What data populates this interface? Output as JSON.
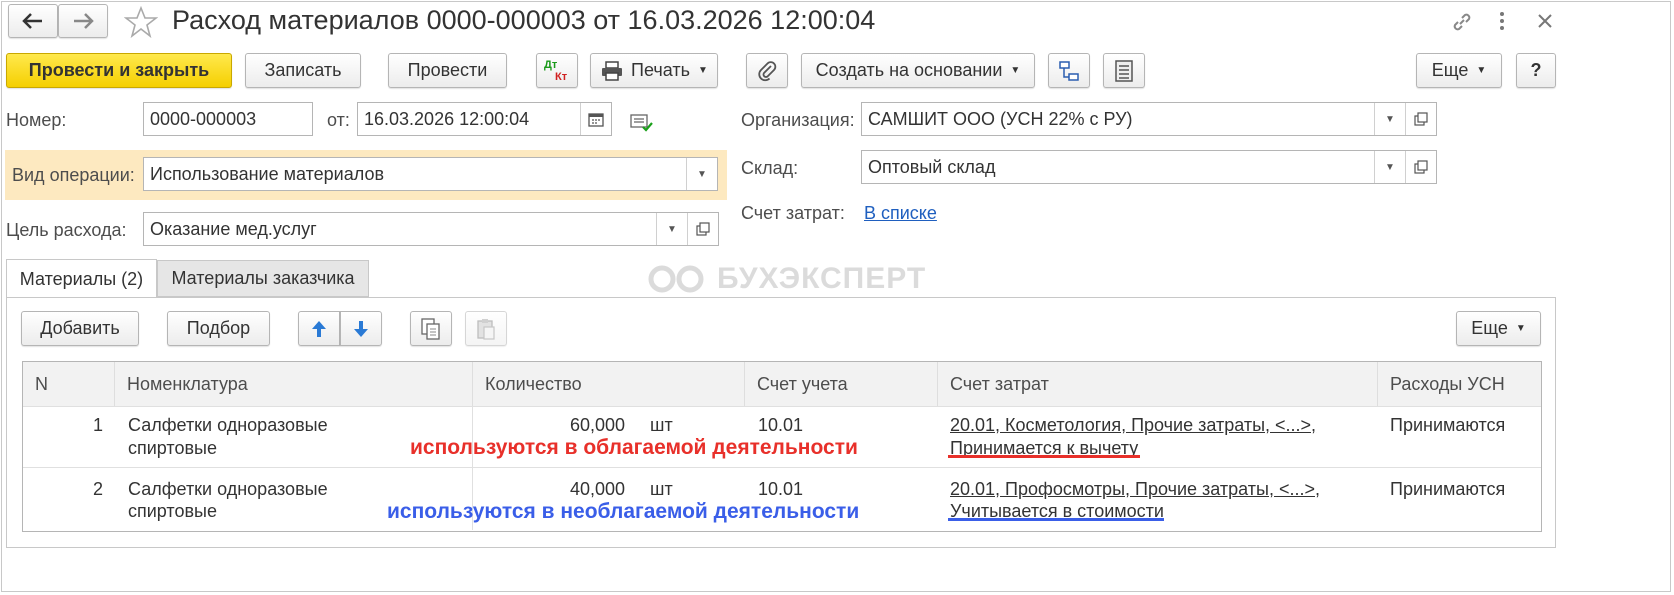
{
  "window": {
    "title": "Расход материалов 0000-000003 от 16.03.2026 12:00:04"
  },
  "toolbar": {
    "post_close": "Провести и закрыть",
    "save": "Записать",
    "post": "Провести",
    "print": "Печать",
    "create_based": "Создать на основании",
    "more": "Еще",
    "help": "?",
    "dt_label": "Дт",
    "kt_label": "Кт"
  },
  "form": {
    "number_label": "Номер:",
    "number_value": "0000-000003",
    "date_label": "от:",
    "date_value": "16.03.2026 12:00:04",
    "org_label": "Организация:",
    "org_value": "САМШИТ ООО (УСН 22% с РУ)",
    "optype_label": "Вид операции:",
    "optype_value": "Использование материалов",
    "warehouse_label": "Склад:",
    "warehouse_value": "Оптовый склад",
    "purpose_label": "Цель расхода:",
    "purpose_value": "Оказание мед.услуг",
    "cost_account_label": "Счет затрат:",
    "cost_account_link": "В списке"
  },
  "tabs": [
    {
      "label": "Материалы (2)",
      "active": true
    },
    {
      "label": "Материалы заказчика",
      "active": false
    }
  ],
  "watermark": "БУХЭКСПЕРТ",
  "table_toolbar": {
    "add": "Добавить",
    "pick": "Подбор",
    "more": "Еще"
  },
  "table": {
    "columns": [
      "N",
      "Номенклатура",
      "Количество",
      "Счет учета",
      "Счет затрат",
      "Расходы УСН"
    ],
    "rows": [
      {
        "n": "1",
        "item_line1": "Салфетки одноразовые",
        "item_line2": "спиртовые",
        "qty": "60,000",
        "unit": "шт",
        "account": "10.01",
        "cost_line1": "20.01, Косметология, Прочие затраты, <...>,",
        "cost_line2": "Принимается к вычету",
        "usn": "Принимаются",
        "annotation": "используются в облагаемой деятельности"
      },
      {
        "n": "2",
        "item_line1": "Салфетки одноразовые",
        "item_line2": "спиртовые",
        "qty": "40,000",
        "unit": "шт",
        "account": "10.01",
        "cost_line1": "20.01, Профосмотры, Прочие затраты, <...>,",
        "cost_line2": "Учитывается в стоимости",
        "usn": "Принимаются",
        "annotation": "используются в необлагаемой деятельности"
      }
    ]
  },
  "colors": {
    "primary_button": "#f5cf00",
    "link": "#1f5fbf",
    "highlight_row": "#fde9c0",
    "annotation_red": "#e8302a",
    "annotation_blue": "#3a5ee8"
  }
}
